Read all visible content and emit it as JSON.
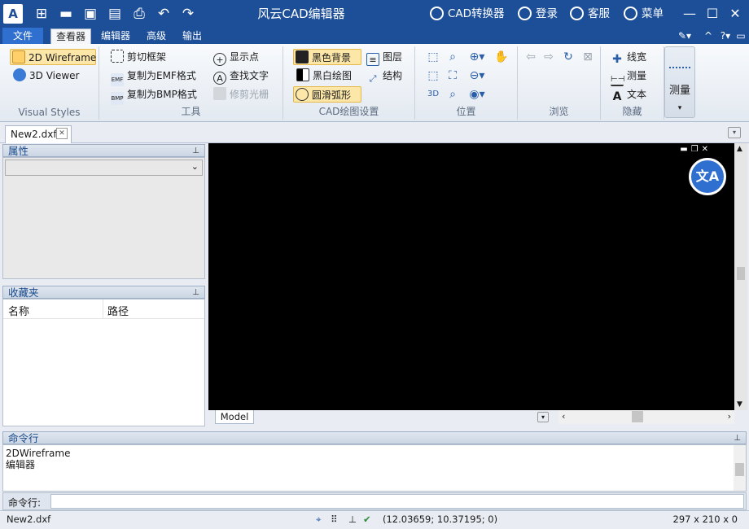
{
  "app": {
    "title": "风云CAD编辑器",
    "logo": "A"
  },
  "quick_access": [
    "new-icon",
    "open-folder-icon",
    "save-icon",
    "save-as-pdf-icon",
    "print-icon",
    "undo-icon",
    "redo-icon"
  ],
  "title_links": {
    "converter": "CAD转换器",
    "login": "登录",
    "service": "客服",
    "menu": "菜单"
  },
  "window_controls": {
    "minimize": "—",
    "maximize": "☐",
    "close": "✕"
  },
  "tabs": {
    "file": "文件",
    "viewer": "查看器",
    "editor": "编辑器",
    "advanced": "高级",
    "output": "输出"
  },
  "ribbon": {
    "visual_styles": {
      "label": "Visual Styles",
      "wireframe": "2D Wireframe",
      "viewer3d": "3D Viewer"
    },
    "tools": {
      "label": "工具",
      "clip_frame": "剪切框架",
      "copy_emf": "复制为EMF格式",
      "copy_bmp": "复制为BMP格式",
      "show_points": "显示点",
      "find_text": "查找文字",
      "trim_raster": "修剪光栅"
    },
    "cad_settings": {
      "label": "CAD绘图设置",
      "black_bg": "黑色背景",
      "bw_drawing": "黑白绘图",
      "smooth_arc": "圆滑弧形",
      "layers": "图层",
      "structure": "结构"
    },
    "position": {
      "label": "位置"
    },
    "browse": {
      "label": "浏览"
    },
    "hide": {
      "label": "隐藏",
      "linewidth": "线宽",
      "measure": "测量",
      "text": "文本"
    },
    "measure_big": "测量"
  },
  "document": {
    "tab": "New2.dxf",
    "model_tab": "Model"
  },
  "panels": {
    "properties": "属性",
    "favorites": "收藏夹",
    "fav_columns": [
      "名称",
      "路径"
    ],
    "command": "命令行"
  },
  "command": {
    "lines": [
      "2DWireframe",
      "编辑器"
    ],
    "prompt": "命令行:"
  },
  "status": {
    "file": "New2.dxf",
    "coords": "(12.03659; 10.37195; 0)",
    "size": "297 x 210 x 0"
  },
  "colors": {
    "title_bar": "#1d4f99",
    "canvas": "#000000",
    "accent": "#2f6fcf"
  }
}
